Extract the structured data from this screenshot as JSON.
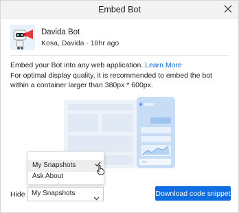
{
  "dialog": {
    "title": "Embed Bot",
    "close_icon": "close-icon"
  },
  "bot": {
    "name": "Davida Bot",
    "owner": "Kosa, Davida",
    "separator": "-",
    "age": "18hr ago",
    "thumbnail_icon": "robot-thumbnail"
  },
  "content": {
    "intro": "Embed your Bot into any web application.",
    "learn_more": "Learn More",
    "note": "For optimal display quality, it is recommended to embed the bot within a container larger than 380px * 600px."
  },
  "dropdown_menu": {
    "options": [
      {
        "label": "My Snapshots",
        "selected": true
      },
      {
        "label": "Ask About",
        "selected": false
      }
    ]
  },
  "hide": {
    "label": "Hide",
    "value": "My Snapshots"
  },
  "actions": {
    "download": "Download code snippet"
  },
  "colors": {
    "accent": "#0e6de0",
    "link": "#0d66d0",
    "illustration_panel": "#c7ddf6"
  }
}
